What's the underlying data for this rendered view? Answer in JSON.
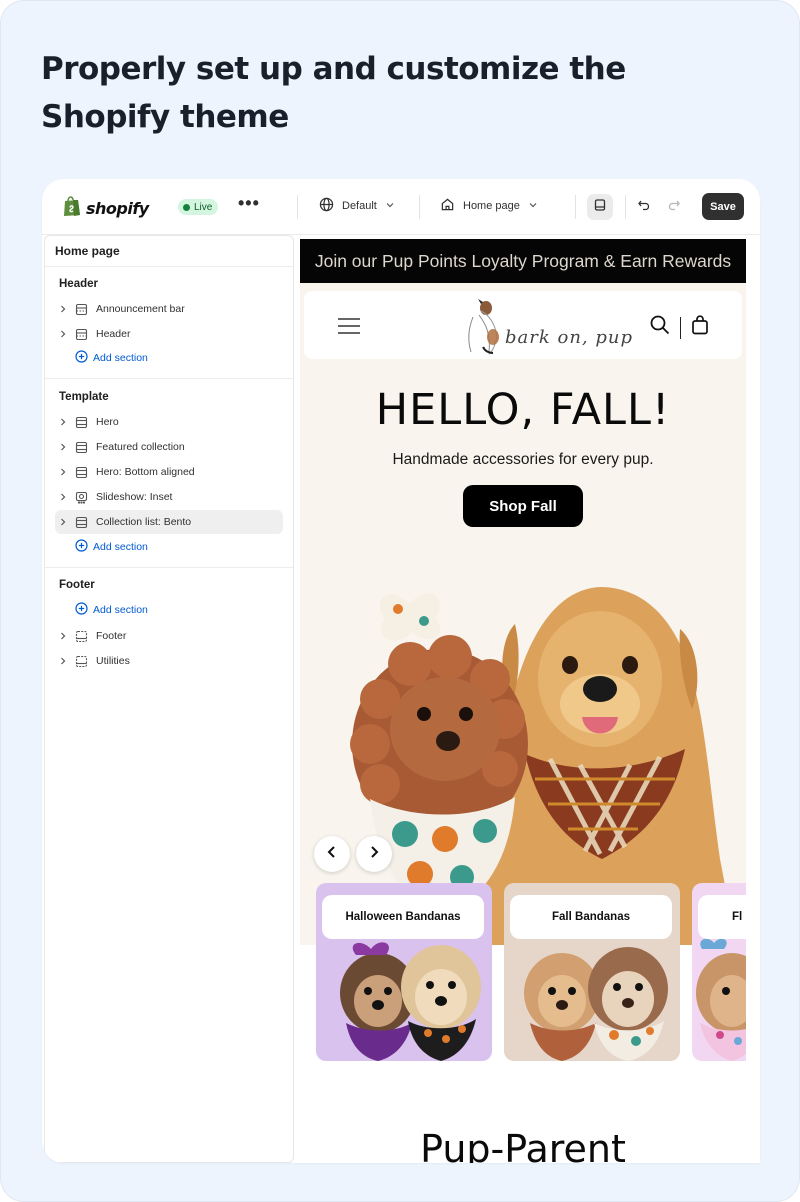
{
  "headline": "Properly set up and customize the Shopify theme",
  "toolbar": {
    "logo_text": "shopify",
    "live_label": "Live",
    "more_label": "•••",
    "theme_label": "Default",
    "page_label": "Home page",
    "save_label": "Save"
  },
  "sidebar": {
    "title": "Home page",
    "header_group": "Header",
    "header_items": [
      {
        "label": "Announcement bar",
        "icon": "section-icon"
      },
      {
        "label": "Header",
        "icon": "section-icon"
      }
    ],
    "template_group": "Template",
    "template_items": [
      {
        "label": "Hero",
        "icon": "section-icon"
      },
      {
        "label": "Featured collection",
        "icon": "section-icon"
      },
      {
        "label": "Hero: Bottom aligned",
        "icon": "section-icon"
      },
      {
        "label": "Slideshow: Inset",
        "icon": "slideshow-icon"
      },
      {
        "label": "Collection list: Bento",
        "icon": "section-icon",
        "selected": true
      }
    ],
    "footer_group": "Footer",
    "footer_items": [
      {
        "label": "Footer",
        "icon": "footer-icon"
      },
      {
        "label": "Utilities",
        "icon": "footer-icon"
      }
    ],
    "add_section_label": "Add section"
  },
  "preview": {
    "announcement": "Join our Pup Points Loyalty Program & Earn Rewards",
    "brand": "bark on, pup",
    "hero_title": "HELLO, FALL!",
    "hero_subtitle": "Handmade accessories for every pup.",
    "hero_button": "Shop Fall",
    "collections": [
      {
        "label": "Halloween Bandanas",
        "bg": "#d9c3ee"
      },
      {
        "label": "Fall Bandanas",
        "bg": "#e6d6ca"
      },
      {
        "label": "Fl",
        "bg": "#f1d7f2"
      }
    ],
    "section_heading": "Pup-Parent"
  },
  "colors": {
    "card_bg": "#eef4fd",
    "live_badge": "#d4f5df",
    "link_blue": "#005bd3",
    "save_button": "#303030",
    "announcement_bg": "#050505",
    "hero_bg": "#f9f5ee"
  }
}
